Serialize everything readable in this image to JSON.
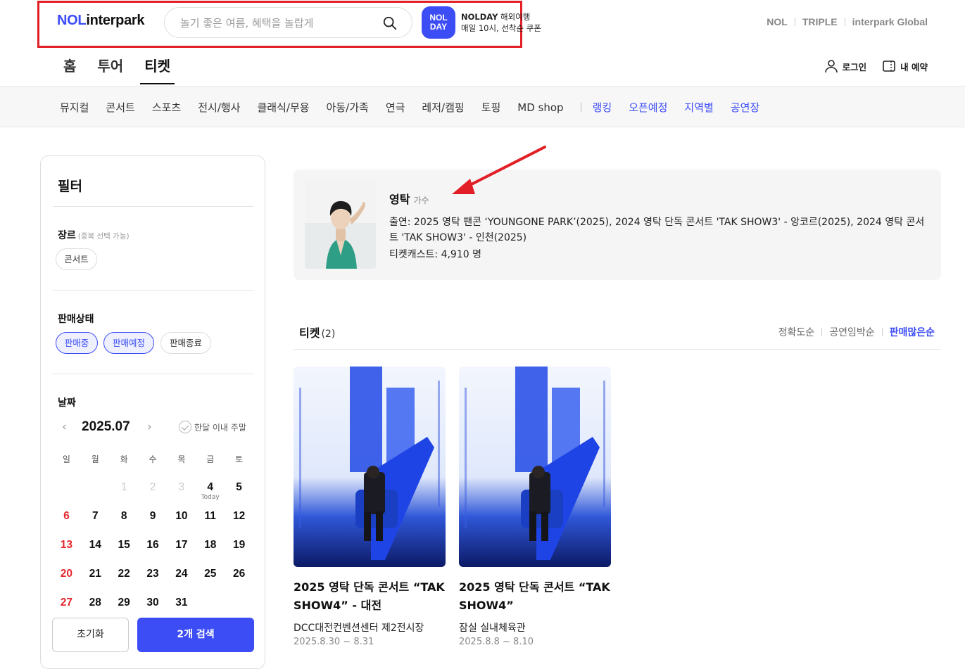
{
  "header": {
    "logo_nol": "NOL",
    "logo_rest": "interpark",
    "search_placeholder": "놀기 좋은 여름, 혜택을 놀랍게",
    "nolday_badge_top": "NOL",
    "nolday_badge_bottom": "DAY",
    "nolday_line1_bold": "NOLDAY",
    "nolday_line1_rest": " 해외여행",
    "nolday_line2": "매일 10시, 선착순 쿠폰",
    "brands": [
      "NOL",
      "TRIPLE",
      "interpark Global"
    ],
    "main_tabs": [
      "홈",
      "투어",
      "티켓"
    ],
    "active_tab": "티켓",
    "login": "로그인",
    "my_booking": "내 예약",
    "highlight_color": "#e21e26"
  },
  "categories": {
    "items": [
      "뮤지컬",
      "콘서트",
      "스포츠",
      "전시/행사",
      "클래식/무용",
      "아동/가족",
      "연극",
      "레저/캠핑",
      "토핑",
      "MD shop"
    ],
    "blue_items": [
      "랭킹",
      "오픈예정",
      "지역별",
      "공연장"
    ]
  },
  "filter": {
    "title": "필터",
    "genre_label": "장르",
    "genre_sub": "(중복 선택 가능)",
    "genre_chip": "콘서트",
    "status_label": "판매상태",
    "status_chips": [
      "판매중",
      "판매예정",
      "판매종료"
    ],
    "date_label": "날짜",
    "month": "2025.07",
    "weekend_toggle": "한달 이내 주말",
    "weekdays": [
      "일",
      "월",
      "화",
      "수",
      "목",
      "금",
      "토"
    ],
    "today_label": "Today",
    "reset": "초기화",
    "search": "2개 검색"
  },
  "artist": {
    "name": "영탁",
    "role": "가수",
    "appearances": "출연: 2025 영탁 팬콘 ‘YOUNGONE PARK’(2025), 2024 영탁 단독 콘서트 'TAK SHOW3' - 앙코르(2025), 2024 영탁 콘서트 'TAK SHOW3' - 인천(2025)",
    "ticketcast": "티켓캐스트: 4,910 명"
  },
  "tickets": {
    "label": "티켓",
    "count": "(2)",
    "sorts": [
      "정확도순",
      "공연임박순",
      "판매많은순"
    ],
    "active_sort": "판매많은순",
    "items": [
      {
        "title": "2025 영탁 단독 콘서트 “TAK SHOW4” - 대전",
        "venue": "DCC대전컨벤션센터 제2전시장",
        "date": "2025.8.30 ~ 8.31"
      },
      {
        "title": "2025 영탁 단독 콘서트 “TAK SHOW4”",
        "venue": "잠실 실내체육관",
        "date": "2025.8.8 ~ 8.10"
      }
    ]
  },
  "colors": {
    "accent": "#3d4df5",
    "sunday": "#e5262c"
  }
}
